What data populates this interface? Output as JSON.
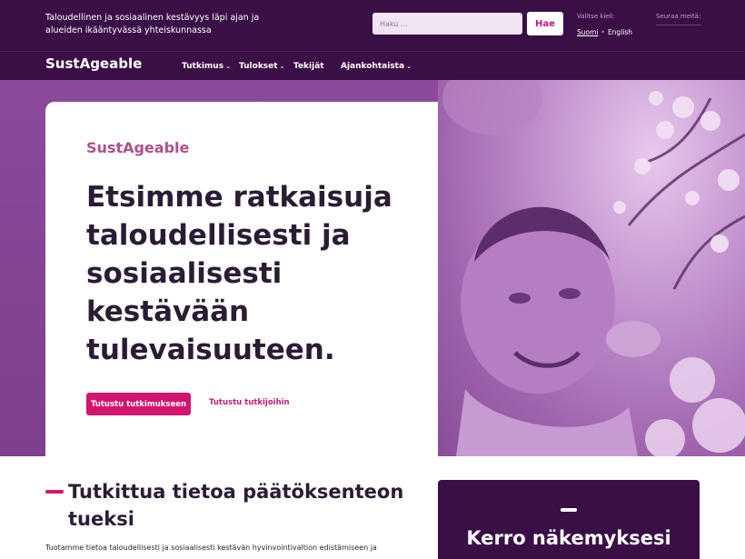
{
  "header": {
    "tagline": "Taloudellinen ja sosiaalinen kestävyys läpi ajan ja alueiden ikääntyvässä yhteiskunnassa",
    "search_placeholder": "Haku ...",
    "search_button": "Hae",
    "language_label": "Valitse kieli:",
    "languages": [
      "Suomi",
      "English"
    ],
    "language_separator": "•",
    "follow_label": "Seuraa meitä:"
  },
  "nav": {
    "logo": "SustAgeable",
    "items": [
      {
        "label": "Tutkimus",
        "has_dropdown": true,
        "dropdown_icon": "chevron-down-icon"
      },
      {
        "label": "Tulokset",
        "has_dropdown": true,
        "dropdown_icon": "chevron-down-icon"
      },
      {
        "label": "Tekijät",
        "has_dropdown": false
      },
      {
        "label": "Ajankohtaista",
        "has_dropdown": true,
        "dropdown_icon": "chevron-down-icon"
      }
    ],
    "chevron": "⌄"
  },
  "hero": {
    "eyebrow": "SustAgeable",
    "headline": "Etsimme ratkaisuja taloudellisesti ja sosiaalisesti kestävään tulevaisuuteen.",
    "primary_button": "Tutustu tutkimukseen",
    "secondary_link": "Tutustu tutkijoihin"
  },
  "section": {
    "title": "Tutkittua tietoa päätöksenteon tueksi",
    "body": "Tuotamme tietoa taloudellisesti ja sosiaalisesti kestävän hyvinvointivaltion edistämiseen ja"
  },
  "feedback": {
    "title": "Kerro näkemyksesi"
  },
  "colors": {
    "header_bg": "#3a0f45",
    "accent": "#d3156f",
    "eyebrow": "#b0508d",
    "hero_bg": "#8c4a9a",
    "text": "#2b1c35"
  }
}
